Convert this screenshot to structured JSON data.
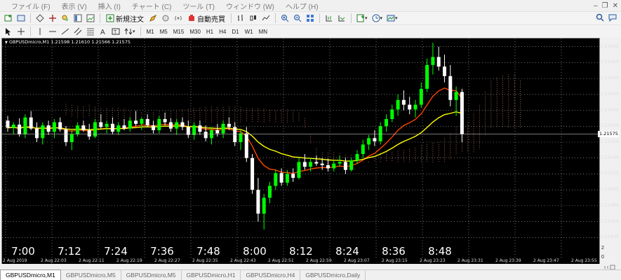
{
  "menu": [
    "ファイル (F)",
    "表示 (V)",
    "挿入 (I)",
    "チャート (C)",
    "ツール (T)",
    "ウィンドウ (W)",
    "ヘルプ (H)"
  ],
  "toolbar": {
    "new_order_label": "新規注文",
    "autotrade_label": "自動売買"
  },
  "timeframes": [
    "M1",
    "M5",
    "M15",
    "M30",
    "H1",
    "H4",
    "D1",
    "W1",
    "MN"
  ],
  "chart": {
    "symbol_line": "GBPUSDmicro,M1  1.21598 1.21610 1.21566 1.21575",
    "current_price": "1.21575",
    "right_corner_values": [
      "2",
      "0"
    ],
    "colors": {
      "background": "#000000",
      "bull": "#00ff00",
      "bear": "#ffffff",
      "ma_fast": "#ff4500",
      "ma_slow": "#ffff00",
      "cloud": "#ffa07a",
      "grid": "#ffffff"
    }
  },
  "chart_data": {
    "type": "candlestick",
    "price_ticks": [
      "1.21685",
      "1.21665",
      "1.21645",
      "1.21625",
      "1.21605",
      "1.21585",
      "1.21565",
      "1.21545",
      "1.21525",
      "1.21505",
      "1.21485",
      "1.21465",
      "1.21445"
    ],
    "time_annotations": [
      "7:00",
      "7:12",
      "7:24",
      "7:36",
      "7:48",
      "8:00",
      "8:12",
      "8:24",
      "8:36",
      "8:48"
    ],
    "date_axis": [
      "2 Aug 2019",
      "2 Aug 22:03",
      "2 Aug 22:11",
      "2 Aug 22:19",
      "2 Aug 22:27",
      "2 Aug 22:35",
      "2 Aug 22:43",
      "2 Aug 22:51",
      "2 Aug 22:59",
      "2 Aug 23:07",
      "2 Aug 23:15",
      "2 Aug 23:23",
      "2 Aug 23:31",
      "2 Aug 23:39",
      "2 Aug 23:47",
      "2 Aug 23:55"
    ],
    "ylim": [
      1.2144,
      1.2169
    ],
    "candles": [
      [
        1.21592,
        1.21598,
        1.21578,
        1.21583
      ],
      [
        1.21583,
        1.2159,
        1.21575,
        1.21587
      ],
      [
        1.21587,
        1.21595,
        1.21572,
        1.21575
      ],
      [
        1.21575,
        1.216,
        1.2157,
        1.21596
      ],
      [
        1.21596,
        1.21604,
        1.2158,
        1.21582
      ],
      [
        1.21582,
        1.2159,
        1.21565,
        1.2157
      ],
      [
        1.2157,
        1.2159,
        1.21562,
        1.21586
      ],
      [
        1.21586,
        1.21592,
        1.21574,
        1.21578
      ],
      [
        1.21578,
        1.21594,
        1.2157,
        1.2159
      ],
      [
        1.2159,
        1.21596,
        1.21578,
        1.21581
      ],
      [
        1.21581,
        1.21585,
        1.2156,
        1.21565
      ],
      [
        1.21565,
        1.2158,
        1.21555,
        1.21575
      ],
      [
        1.21575,
        1.2159,
        1.21572,
        1.21586
      ],
      [
        1.21586,
        1.21592,
        1.21578,
        1.2158
      ],
      [
        1.2158,
        1.21588,
        1.21568,
        1.21572
      ],
      [
        1.21572,
        1.21594,
        1.2157,
        1.2159
      ],
      [
        1.2159,
        1.216,
        1.21582,
        1.21584
      ],
      [
        1.21584,
        1.21592,
        1.21576,
        1.21588
      ],
      [
        1.21588,
        1.21596,
        1.21575,
        1.21578
      ],
      [
        1.21578,
        1.2159,
        1.21574,
        1.21586
      ],
      [
        1.21586,
        1.21594,
        1.2158,
        1.21582
      ],
      [
        1.21582,
        1.21596,
        1.21578,
        1.21592
      ],
      [
        1.21592,
        1.21604,
        1.21585,
        1.21588
      ],
      [
        1.21588,
        1.21596,
        1.2158,
        1.21594
      ],
      [
        1.21594,
        1.216,
        1.21584,
        1.21586
      ],
      [
        1.21586,
        1.21592,
        1.21576,
        1.2158
      ],
      [
        1.2158,
        1.21598,
        1.21576,
        1.21594
      ],
      [
        1.21594,
        1.21602,
        1.21586,
        1.2159
      ],
      [
        1.2159,
        1.21595,
        1.21578,
        1.21582
      ],
      [
        1.21582,
        1.21594,
        1.21574,
        1.2159
      ],
      [
        1.2159,
        1.21596,
        1.2158,
        1.21584
      ],
      [
        1.21584,
        1.21592,
        1.2157,
        1.21574
      ],
      [
        1.21574,
        1.2159,
        1.21568,
        1.21586
      ],
      [
        1.21586,
        1.21592,
        1.21574,
        1.21578
      ],
      [
        1.21578,
        1.21586,
        1.21566,
        1.2157
      ],
      [
        1.2157,
        1.21584,
        1.21562,
        1.2158
      ],
      [
        1.2158,
        1.21588,
        1.21572,
        1.21576
      ],
      [
        1.21576,
        1.21592,
        1.2157,
        1.21588
      ],
      [
        1.21588,
        1.21596,
        1.2158,
        1.21584
      ],
      [
        1.21584,
        1.2159,
        1.2156,
        1.21565
      ],
      [
        1.21565,
        1.2158,
        1.21555,
        1.21576
      ],
      [
        1.21576,
        1.21584,
        1.2154,
        1.21545
      ],
      [
        1.21545,
        1.2155,
        1.215,
        1.21505
      ],
      [
        1.21505,
        1.2152,
        1.21465,
        1.21475
      ],
      [
        1.21475,
        1.215,
        1.21455,
        1.21495
      ],
      [
        1.21495,
        1.21515,
        1.21488,
        1.2151
      ],
      [
        1.2151,
        1.2153,
        1.21505,
        1.21526
      ],
      [
        1.21526,
        1.21532,
        1.2151,
        1.21514
      ],
      [
        1.21514,
        1.2153,
        1.2151,
        1.21525
      ],
      [
        1.21525,
        1.21532,
        1.21515,
        1.2152
      ],
      [
        1.2152,
        1.21545,
        1.21518,
        1.2154
      ],
      [
        1.2154,
        1.2155,
        1.2153,
        1.21534
      ],
      [
        1.21534,
        1.21545,
        1.21528,
        1.2154
      ],
      [
        1.2154,
        1.21548,
        1.21535,
        1.21538
      ],
      [
        1.21538,
        1.21545,
        1.2153,
        1.21536
      ],
      [
        1.21536,
        1.21544,
        1.21528,
        1.21532
      ],
      [
        1.21532,
        1.21542,
        1.21528,
        1.21538
      ],
      [
        1.21538,
        1.21548,
        1.21534,
        1.2154
      ],
      [
        1.2154,
        1.21545,
        1.21525,
        1.2153
      ],
      [
        1.2153,
        1.21545,
        1.21528,
        1.21542
      ],
      [
        1.21542,
        1.21555,
        1.21538,
        1.2155
      ],
      [
        1.2155,
        1.21568,
        1.21545,
        1.21562
      ],
      [
        1.21562,
        1.21574,
        1.21555,
        1.2157
      ],
      [
        1.2157,
        1.2158,
        1.2156,
        1.21566
      ],
      [
        1.21566,
        1.2159,
        1.21562,
        1.21585
      ],
      [
        1.21585,
        1.216,
        1.21578,
        1.21594
      ],
      [
        1.21594,
        1.21612,
        1.2159,
        1.21606
      ],
      [
        1.21606,
        1.21625,
        1.21598,
        1.21618
      ],
      [
        1.21618,
        1.2163,
        1.21605,
        1.21612
      ],
      [
        1.21612,
        1.21622,
        1.216,
        1.21606
      ],
      [
        1.21606,
        1.21618,
        1.21596,
        1.21612
      ],
      [
        1.21612,
        1.2164,
        1.21608,
        1.21632
      ],
      [
        1.21632,
        1.2167,
        1.21628,
        1.21662
      ],
      [
        1.21662,
        1.2169,
        1.2165,
        1.21672
      ],
      [
        1.21672,
        1.21685,
        1.21655,
        1.2166
      ],
      [
        1.2166,
        1.21675,
        1.2164,
        1.21648
      ],
      [
        1.21648,
        1.21662,
        1.2161,
        1.21618
      ],
      [
        1.21618,
        1.21635,
        1.21598,
        1.21628
      ],
      [
        1.21628,
        1.21632,
        1.21565,
        1.21575
      ]
    ]
  },
  "tabs": [
    "GBPUSDmicro,M1",
    "GBPUSDmicro,M5",
    "GBPUSDmicro,M5",
    "GBPUSDmicro,H1",
    "GBPUSDmicro,H4",
    "GBPUSDmicro,Daily"
  ]
}
